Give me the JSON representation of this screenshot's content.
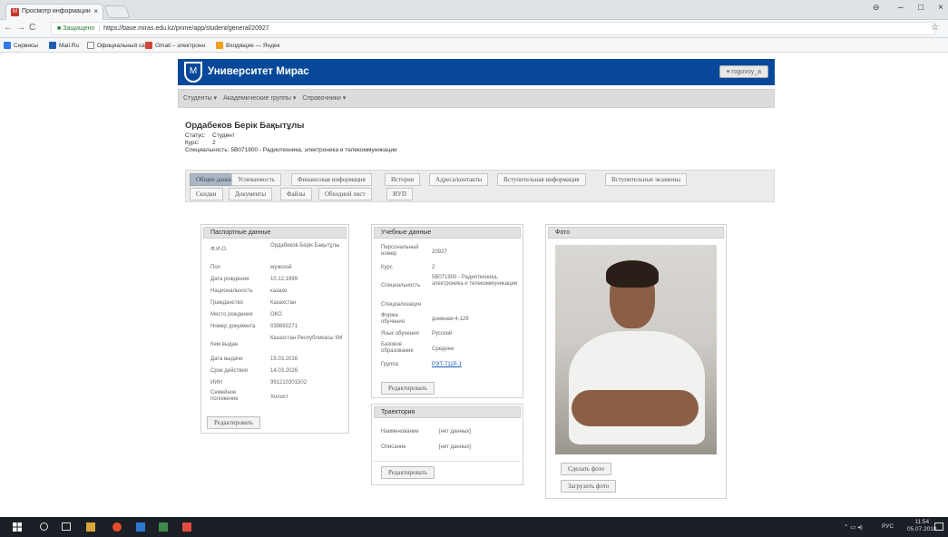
{
  "browser": {
    "tab_title": "Просмотр информации",
    "tab_close": "×",
    "win_min": "–",
    "win_max": "□",
    "win_close": "×",
    "url_secure": "Защищено",
    "url": "https://base.miras.edu.kz/prime/app/student/general/20927",
    "bookmarks": [
      "Сервисы",
      "Mail.Ru",
      "Официальный сайт",
      "Gmail – электронн",
      "Входящие — Яндек"
    ]
  },
  "header": {
    "brand": "Университет Мирас",
    "user_menu": "▾ rogovoy_a"
  },
  "menu": {
    "items": [
      "Студенты ▾",
      "Академические группы ▾",
      "Справочники ▾"
    ]
  },
  "student": {
    "name": "Ордабеков Берік Бақытұлы",
    "status_label": "Статус:",
    "status_value": "Студент",
    "course_label": "Курс:",
    "course_value": "2",
    "spec_label": "Специальность:",
    "spec_value": "5B071900 - Радиотехника, электроника и телекоммуникации"
  },
  "tabs": {
    "row1": [
      "Общие данные",
      "Успеваемость",
      "Финансовая информация",
      "История",
      "Адреса/контакты",
      "Вступительная информация",
      "Вступительные экзамены"
    ],
    "row2": [
      "Скидки",
      "Документы",
      "Файлы",
      "Обходной лист",
      "ИУП"
    ]
  },
  "passport": {
    "title": "Паспортные данные",
    "rows": [
      {
        "label": "Ф.И.О.",
        "value": "Ордабеков Берік Бақытұлы"
      },
      {
        "label": "Пол",
        "value": "мужской"
      },
      {
        "label": "Дата рождения",
        "value": "10.12.1999"
      },
      {
        "label": "Национальность",
        "value": "казахи"
      },
      {
        "label": "Гражданство",
        "value": "Казахстан"
      },
      {
        "label": "Место рождения",
        "value": "ОКО"
      },
      {
        "label": "Номер документа",
        "value": "039883271"
      },
      {
        "label": "Кем выдан",
        "value": "Казахстан Республикасы ІІМ"
      },
      {
        "label": "Дата выдачи",
        "value": "15.03.2016"
      },
      {
        "label": "Срок действия",
        "value": "14.03.2026"
      },
      {
        "label": "ИИН",
        "value": "991210301502"
      },
      {
        "label": "Семейное положение",
        "value": "Холост"
      }
    ],
    "edit": "Редактировать"
  },
  "study": {
    "title": "Учебные данные",
    "rows": [
      {
        "label": "Персональный номер",
        "value": "20927"
      },
      {
        "label": "Курс",
        "value": "2"
      },
      {
        "label": "Специальность",
        "value": "5B071900 - Радиотехника, электроника и телекоммуникации"
      },
      {
        "label": "Специализация",
        "value": ""
      },
      {
        "label": "Форма обучения",
        "value": "дневная-4-129"
      },
      {
        "label": "Язык обучения",
        "value": "Русский"
      },
      {
        "label": "Базовое образование",
        "value": "Среднее"
      },
      {
        "label": "Группа",
        "value": "РЭТ-711Р-1"
      }
    ],
    "edit": "Редактировать"
  },
  "trajectory": {
    "title": "Траектория",
    "rows": [
      {
        "label": "Наименование",
        "value": "[нет данных]"
      },
      {
        "label": "Описание",
        "value": "[нет данных]"
      }
    ],
    "edit": "Редактировать"
  },
  "photo": {
    "title": "Фото",
    "take": "Сделать фото",
    "upload": "Загрузить фото"
  },
  "taskbar": {
    "lang": "РУС",
    "time": "11:54",
    "date": "05.07.2018"
  }
}
